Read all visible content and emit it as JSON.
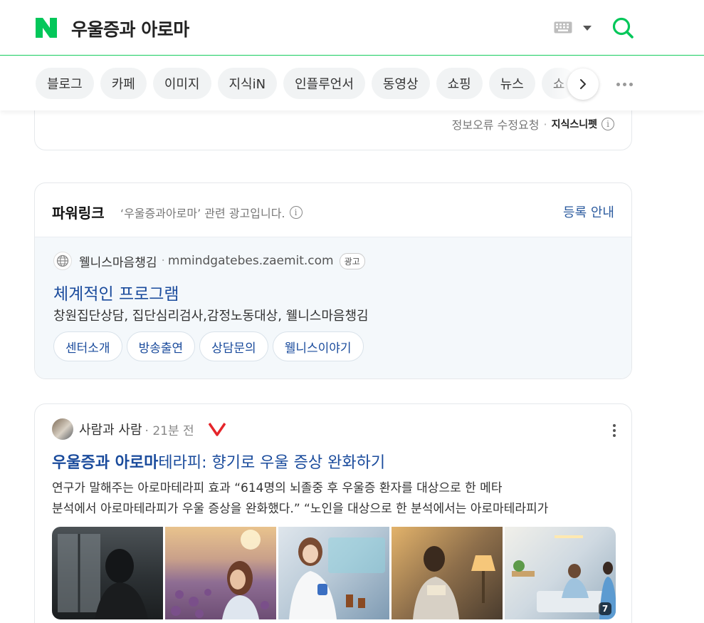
{
  "header": {
    "query": "우울증과 아로마",
    "logo_letter": "N",
    "brand_color": "#03c75a"
  },
  "tabs": [
    {
      "label": "블로그"
    },
    {
      "label": "카페"
    },
    {
      "label": "이미지"
    },
    {
      "label": "지식iN"
    },
    {
      "label": "인플루언서"
    },
    {
      "label": "동영상"
    },
    {
      "label": "쇼핑"
    },
    {
      "label": "뉴스"
    },
    {
      "label": "쇼"
    }
  ],
  "snippet": {
    "report_label": "정보오류 수정요청",
    "brand_label": "지식스니펫",
    "info_glyph": "i"
  },
  "powerlink": {
    "title": "파워링크",
    "subtitle": "‘우울증과아로마’ 관련 광고입니다.",
    "register_label": "등록 안내",
    "ad": {
      "site_name": "웰니스마음챙김",
      "url": "mmindgatebes.zaemit.com",
      "badge": "광고",
      "title": "체계적인 프로그램",
      "description": "창원집단상담, 집단심리검사,감정노동대상, 웰니스마음챙김",
      "links": [
        {
          "label": "센터소개"
        },
        {
          "label": "방송출연"
        },
        {
          "label": "상담문의"
        },
        {
          "label": "웰니스이야기"
        }
      ]
    }
  },
  "blog": {
    "author": "사람과 사람",
    "time": "21분 전",
    "title_highlight": "우울증과 아로마",
    "title_rest": "테라피: 향기로 우울 증상 완화하기",
    "desc_line1": "연구가 말해주는 아로마테라피 효과 “614명의 뇌졸중 후 우울증 환자를 대상으로 한 메타",
    "desc_line2": "분석에서 아로마테라피가 우울 증상을 완화했다.” “노인을 대상으로 한 분석에서는 아로마테라피가",
    "image_count": "7"
  }
}
